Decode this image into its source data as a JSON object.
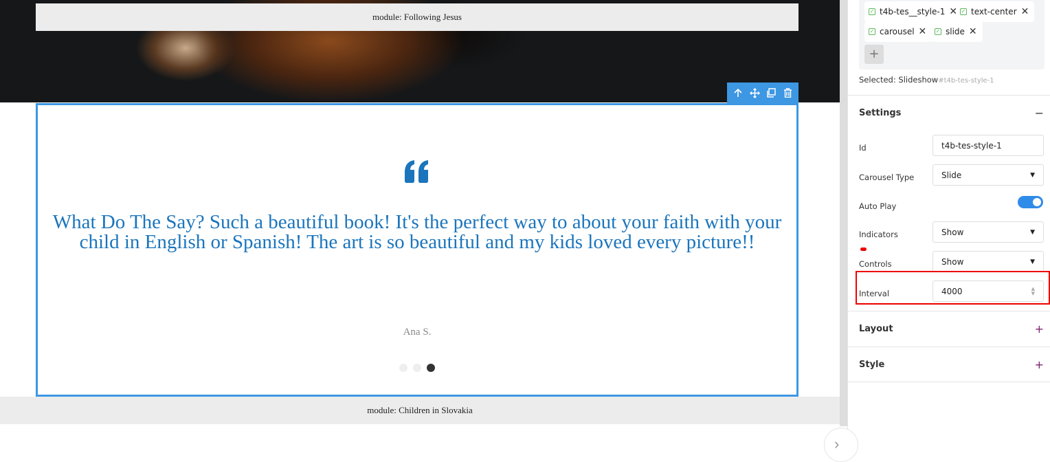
{
  "canvas": {
    "module_top": "module: Following Jesus",
    "module_bottom": "module: Children in Slovakia",
    "toolbar": [
      "arrow-up-icon",
      "move-icon",
      "copy-icon",
      "trash-icon"
    ],
    "testimonial": {
      "quote": "What Do The Say? Such a beautiful book! It's the perfect way to about your faith with your child in English or Spanish! The art is so beautiful and my kids loved every picture!!",
      "author": "Ana S.",
      "slides": 3,
      "active_slide": 3,
      "quote_color": "#1b75bc"
    },
    "selection_color": "#3d97e3"
  },
  "panel": {
    "tags": [
      "t4b-tes__style-1",
      "text-center",
      "carousel",
      "slide"
    ],
    "add_tag": "+",
    "selected_label": "Selected:",
    "selected_name": "Slideshow",
    "selected_id": "#t4b-tes-style-1",
    "settings": {
      "title": "Settings",
      "toggle": "−",
      "id_label": "Id",
      "id_value": "t4b-tes-style-1",
      "carousel_type_label": "Carousel Type",
      "carousel_type_value": "Slide",
      "autoplay_label": "Auto Play",
      "autoplay_on": true,
      "indicators_label": "Indicators",
      "indicators_value": "Show",
      "controls_label": "Controls",
      "controls_value": "Show",
      "interval_label": "Interval",
      "interval_value": "4000"
    },
    "layout": {
      "title": "Layout",
      "toggle": "+"
    },
    "style": {
      "title": "Style",
      "toggle": "+"
    }
  }
}
